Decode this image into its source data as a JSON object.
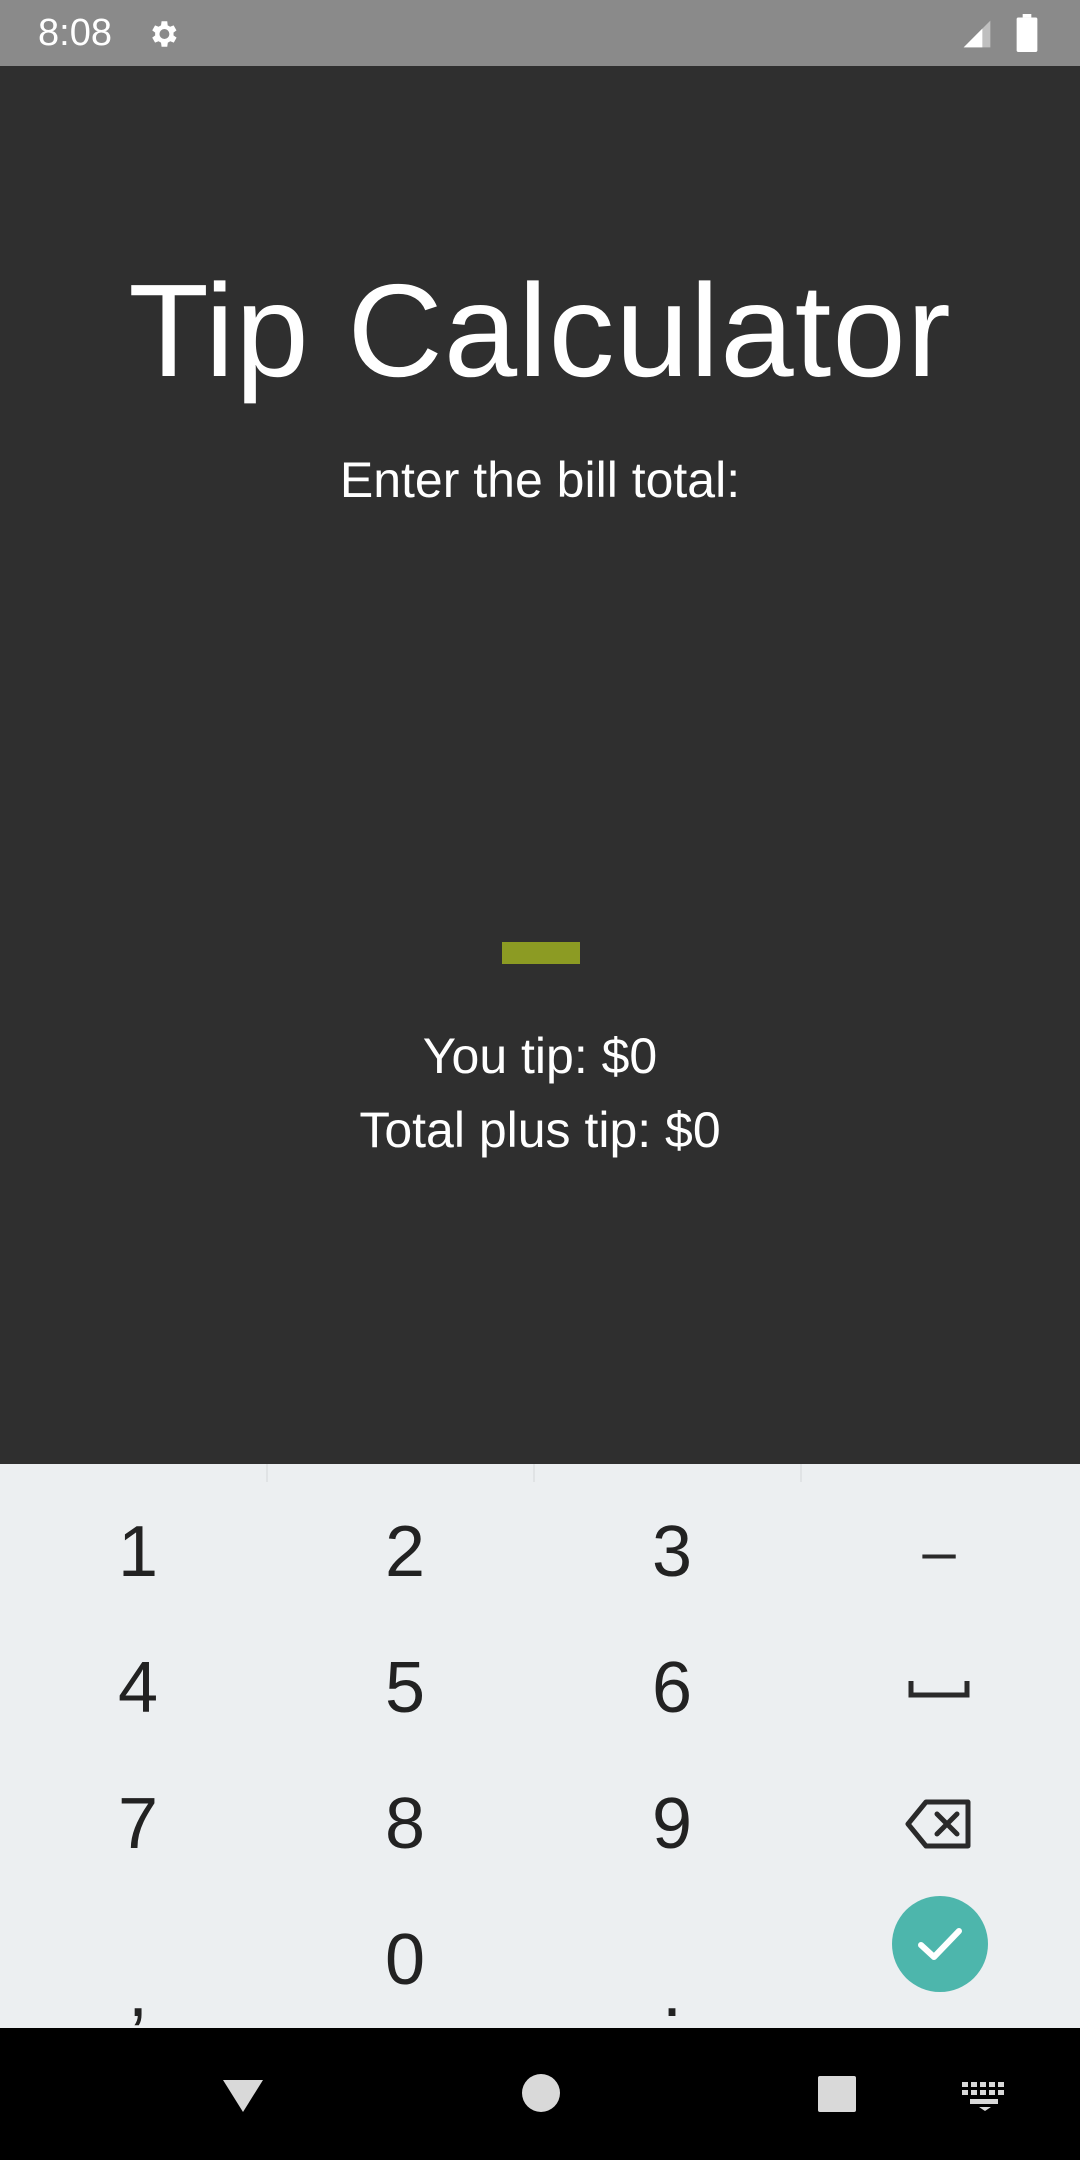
{
  "status_bar": {
    "time": "8:08",
    "icons": [
      "gear-icon",
      "signal-icon",
      "battery-icon"
    ]
  },
  "app": {
    "title": "Tip Calculator",
    "prompt": "Enter the bill total:",
    "bill_value": "",
    "tip_text": "You tip: $0",
    "total_text": "Total plus tip: $0"
  },
  "keyboard": {
    "rows": [
      [
        "1",
        "2",
        "3",
        "–"
      ],
      [
        "4",
        "5",
        "6",
        "space-icon"
      ],
      [
        "7",
        "8",
        "9",
        "backspace-icon"
      ],
      [
        ",",
        "0",
        ".",
        "check-icon"
      ]
    ],
    "keys": {
      "k1": "1",
      "k2": "2",
      "k3": "3",
      "minus": "–",
      "k4": "4",
      "k5": "5",
      "k6": "6",
      "k7": "7",
      "k8": "8",
      "k9": "9",
      "comma": ",",
      "k0": "0",
      "period": "."
    }
  },
  "nav_bar": {
    "buttons": [
      "back-icon",
      "home-icon",
      "recents-icon",
      "keyboard-switch-icon"
    ]
  },
  "colors": {
    "background": "#2f2f2f",
    "status_bar": "#8a8a8a",
    "accent": "#8c9b23",
    "enter_key": "#4db6ac",
    "keyboard_bg": "#eceff1"
  }
}
